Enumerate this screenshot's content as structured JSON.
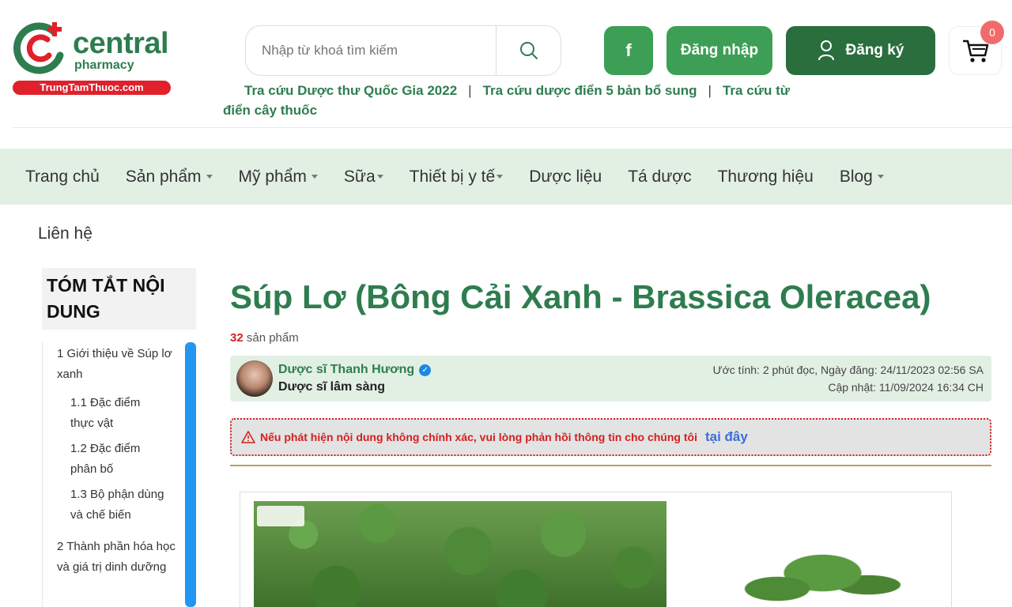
{
  "brand": {
    "name": "central",
    "sub": "pharmacy",
    "site": "TrungTamThuoc.com"
  },
  "search": {
    "placeholder": "Nhập từ khoá tìm kiếm"
  },
  "header_buttons": {
    "facebook": "f",
    "login": "Đăng nhập",
    "register": "Đăng ký",
    "cart_count": "0"
  },
  "quicklinks": [
    "Tra cứu Dược thư Quốc Gia 2022",
    "Tra cứu dược điển 5 bản bổ sung",
    "Tra cứu từ điển cây thuốc"
  ],
  "quicklink_separator": "|",
  "nav": [
    {
      "label": "Trang chủ",
      "dropdown": false
    },
    {
      "label": "Sản phẩm",
      "dropdown": true
    },
    {
      "label": "Mỹ phẩm",
      "dropdown": true
    },
    {
      "label": "Sữa",
      "dropdown": true
    },
    {
      "label": "Thiết bị y tế",
      "dropdown": true
    },
    {
      "label": "Dược liệu",
      "dropdown": false
    },
    {
      "label": "Tá dược",
      "dropdown": false
    },
    {
      "label": "Thương hiệu",
      "dropdown": false
    },
    {
      "label": "Blog",
      "dropdown": true
    }
  ],
  "nav_contact": "Liên hệ",
  "toc": {
    "title": "TÓM TẮT NỘI DUNG",
    "items": [
      "1    Giới thiệu về Súp lơ xanh",
      "1.1    Đặc điểm thực vật",
      "1.2    Đặc điểm phân bố",
      "1.3    Bộ phận dùng và chế biến",
      "2    Thành phần hóa học và giá trị dinh dưỡng"
    ]
  },
  "article": {
    "title": "Súp Lơ (Bông Cải Xanh - Brassica Oleracea)",
    "product_count": "32",
    "product_label": "sản phẩm",
    "author_name": "Dược sĩ Thanh Hương",
    "author_role": "Dược sĩ lâm sàng",
    "meta_line1": "Ước tính: 2 phút đọc, Ngày đăng: 24/11/2023 02:56 SA",
    "meta_line2": "Cập nhật: 11/09/2024 16:34 CH",
    "warning_text": "Nếu phát hiện nội dung không chính xác, vui lòng phản hồi thông tin cho chúng tôi",
    "warning_link": "tại đây"
  },
  "colors": {
    "brand_green": "#2e7d4f",
    "button_green": "#3d9f55",
    "register_green": "#2a6e3e",
    "nav_bg": "#e2f0e4",
    "alert_red": "#d32020"
  },
  "icons": {
    "search": "search-icon",
    "user": "user-icon",
    "cart": "cart-icon",
    "warning": "warning-icon",
    "verified": "verified-icon"
  }
}
